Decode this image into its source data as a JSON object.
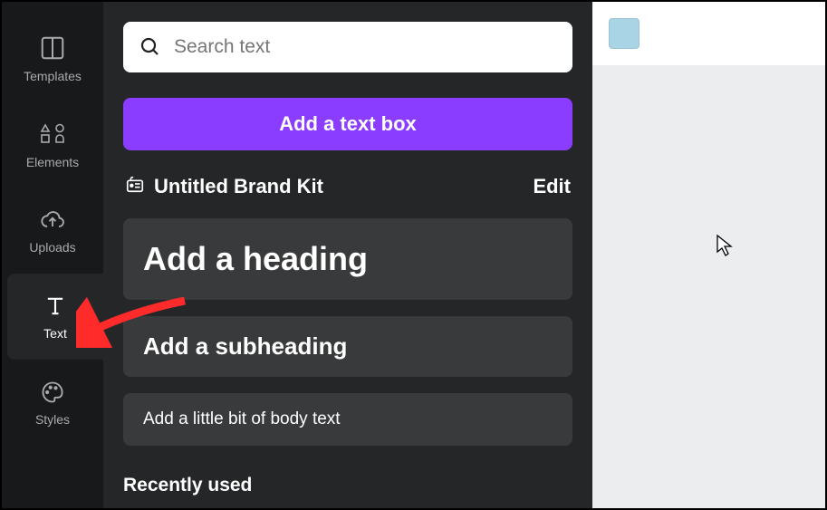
{
  "sidebar": {
    "items": [
      {
        "label": "Templates"
      },
      {
        "label": "Elements"
      },
      {
        "label": "Uploads"
      },
      {
        "label": "Text"
      },
      {
        "label": "Styles"
      }
    ]
  },
  "panel": {
    "search_placeholder": "Search text",
    "primary_button": "Add a text box",
    "brand_kit": "Untitled Brand Kit",
    "edit_label": "Edit",
    "heading_label": "Add a heading",
    "subheading_label": "Add a subheading",
    "body_label": "Add a little bit of body text",
    "recently_used": "Recently used"
  },
  "canvas": {
    "swatch_color": "#a9d4e5"
  },
  "collapse_glyph": "‹"
}
